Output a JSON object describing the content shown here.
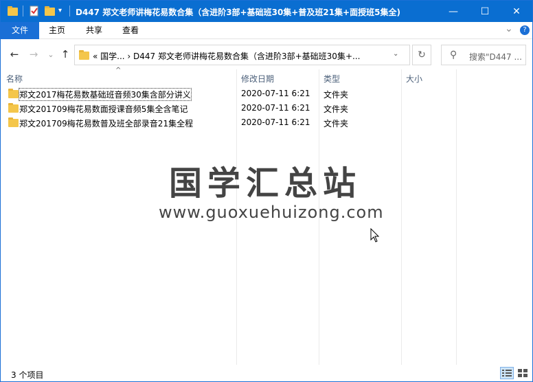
{
  "window": {
    "title": "D447 郑文老师讲梅花易数合集（含进阶3部+基础班30集+普及班21集+面授班5集全)",
    "minimize_glyph": "—",
    "maximize_glyph": "☐",
    "close_glyph": "✕"
  },
  "ribbon": {
    "tabs": [
      "文件",
      "主页",
      "共享",
      "查看"
    ],
    "expand_glyph": "⌄",
    "help_glyph": "?"
  },
  "nav": {
    "back_glyph": "←",
    "forward_glyph": "→",
    "recent_glyph": "⌄",
    "up_glyph": "↑",
    "address_text": "«  国学...  ›  D447 郑文老师讲梅花易数合集（含进阶3部+基础班30集+...",
    "address_dropdown_glyph": "⌄",
    "refresh_glyph": "↻",
    "search_placeholder": "搜索\"D447 ...",
    "search_glyph": "⚲"
  },
  "columns": {
    "name": "名称",
    "date": "修改日期",
    "type": "类型",
    "size": "大小",
    "sort_glyph": "^"
  },
  "files": [
    {
      "name": "郑文2017梅花易数基础班音频30集含部分讲义",
      "date": "2020-07-11 6:21",
      "type": "文件夹"
    },
    {
      "name": "郑文201709梅花易数面授课音频5集全含笔记",
      "date": "2020-07-11 6:21",
      "type": "文件夹"
    },
    {
      "name": "郑文201709梅花易数普及班全部录音21集全程",
      "date": "2020-07-11 6:21",
      "type": "文件夹"
    }
  ],
  "watermark": {
    "title": "国学汇总站",
    "url": "www.guoxuehuizong.com"
  },
  "status": {
    "count_text": "3 个项目"
  },
  "colors": {
    "titlebar": "#0a6ed1",
    "file_tab": "#1a6fd6",
    "folder": "#f4c64b"
  }
}
